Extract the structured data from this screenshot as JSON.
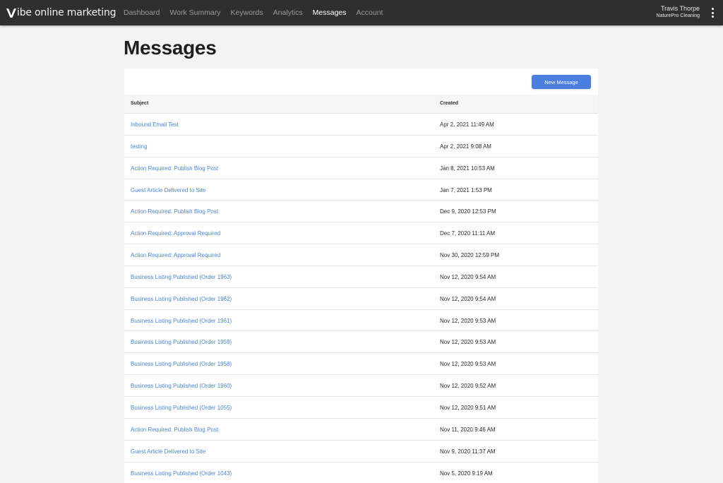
{
  "brand": {
    "logo_text": "ibe online marketing",
    "accent_color": "#4a7fe0",
    "link_color": "#4a86d6",
    "nav_bg": "#2f2f2f"
  },
  "nav": {
    "items": [
      {
        "label": "Dashboard",
        "active": false
      },
      {
        "label": "Work Summary",
        "active": false
      },
      {
        "label": "Keywords",
        "active": false
      },
      {
        "label": "Analytics",
        "active": false
      },
      {
        "label": "Messages",
        "active": true
      },
      {
        "label": "Account",
        "active": false
      }
    ]
  },
  "user": {
    "name": "Travis Thorpe",
    "company": "NaturePro Cleaning",
    "menu_icon": "kebab-menu-icon"
  },
  "page": {
    "title": "Messages",
    "new_button_label": "New Message"
  },
  "table": {
    "columns": [
      "Subject",
      "Created"
    ],
    "rows": [
      {
        "subject": "Inbound Email Test",
        "created": "Apr 2, 2021 11:49 AM"
      },
      {
        "subject": "testing",
        "created": "Apr 2, 2021 9:08 AM"
      },
      {
        "subject": "Action Required: Publish Blog Post",
        "created": "Jan 8, 2021 10:53 AM"
      },
      {
        "subject": "Guest Article Delivered to Site",
        "created": "Jan 7, 2021 1:53 PM"
      },
      {
        "subject": "Action Required: Publish Blog Post",
        "created": "Dec 9, 2020 12:53 PM"
      },
      {
        "subject": "Action Required: Approval Required",
        "created": "Dec 7, 2020 11:11 AM"
      },
      {
        "subject": "Action Required: Approval Required",
        "created": "Nov 30, 2020 12:59 PM"
      },
      {
        "subject": "Business Listing Published (Order 1963)",
        "created": "Nov 12, 2020 9:54 AM"
      },
      {
        "subject": "Business Listing Published (Order 1962)",
        "created": "Nov 12, 2020 9:54 AM"
      },
      {
        "subject": "Business Listing Published (Order 1961)",
        "created": "Nov 12, 2020 9:53 AM"
      },
      {
        "subject": "Business Listing Published (Order 1959)",
        "created": "Nov 12, 2020 9:53 AM"
      },
      {
        "subject": "Business Listing Published (Order 1958)",
        "created": "Nov 12, 2020 9:53 AM"
      },
      {
        "subject": "Business Listing Published (Order 1960)",
        "created": "Nov 12, 2020 9:52 AM"
      },
      {
        "subject": "Business Listing Published (Order 1055)",
        "created": "Nov 12, 2020 9:51 AM"
      },
      {
        "subject": "Action Required: Publish Blog Post",
        "created": "Nov 11, 2020 9:46 AM"
      },
      {
        "subject": "Guest Article Delivered to Site",
        "created": "Nov 9, 2020 11:37 AM"
      },
      {
        "subject": "Business Listing Published (Order 1043)",
        "created": "Nov 5, 2020 9:19 AM"
      }
    ]
  }
}
